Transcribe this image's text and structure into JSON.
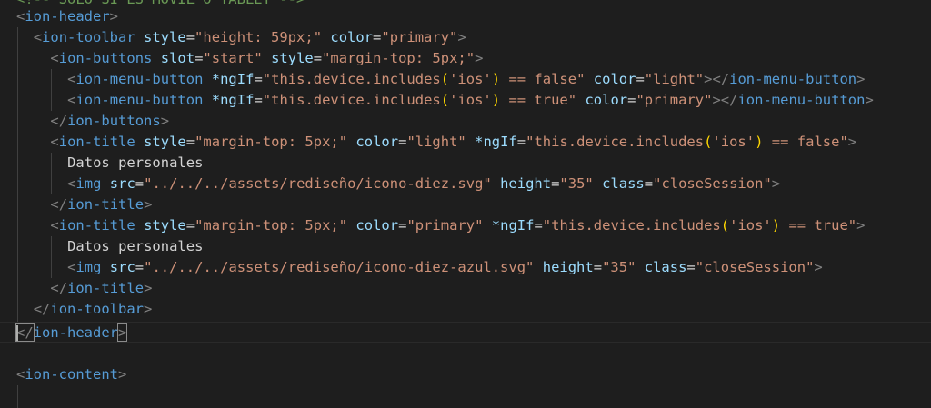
{
  "colors": {
    "background": "#1e1e1e",
    "tag_bracket": "#808080",
    "tag_name": "#569cd6",
    "attribute": "#9cdcfe",
    "string": "#ce9178",
    "text": "#d4d4d4",
    "comment": "#6a9955",
    "paren": "#ffd700"
  },
  "lines": [
    [
      [
        "comment",
        "<!-- SOLO SI ES MOVIL O TABLET -->"
      ]
    ],
    [
      [
        "br",
        "<"
      ],
      [
        "tag",
        "ion-header"
      ],
      [
        "br",
        ">"
      ]
    ],
    [
      [
        "br",
        "<"
      ],
      [
        "tag",
        "ion-toolbar"
      ],
      [
        "t",
        " "
      ],
      [
        "attr",
        "style"
      ],
      [
        "t",
        "="
      ],
      [
        "str",
        "\"height: 59px;\""
      ],
      [
        "t",
        " "
      ],
      [
        "attr",
        "color"
      ],
      [
        "t",
        "="
      ],
      [
        "str",
        "\"primary\""
      ],
      [
        "br",
        ">"
      ]
    ],
    [
      [
        "br",
        "<"
      ],
      [
        "tag",
        "ion-buttons"
      ],
      [
        "t",
        " "
      ],
      [
        "attr",
        "slot"
      ],
      [
        "t",
        "="
      ],
      [
        "str",
        "\"start\""
      ],
      [
        "t",
        " "
      ],
      [
        "attr",
        "style"
      ],
      [
        "t",
        "="
      ],
      [
        "str",
        "\"margin-top: 5px;\""
      ],
      [
        "br",
        ">"
      ]
    ],
    [
      [
        "br",
        "<"
      ],
      [
        "tag",
        "ion-menu-button"
      ],
      [
        "t",
        " "
      ],
      [
        "attr",
        "*ngIf"
      ],
      [
        "t",
        "="
      ],
      [
        "str",
        "\"this.device.includes"
      ],
      [
        "paren",
        "("
      ],
      [
        "str",
        "'ios'"
      ],
      [
        "paren",
        ")"
      ],
      [
        "str",
        " == false\""
      ],
      [
        "t",
        " "
      ],
      [
        "attr",
        "color"
      ],
      [
        "t",
        "="
      ],
      [
        "str",
        "\"light\""
      ],
      [
        "br",
        "></"
      ],
      [
        "tag",
        "ion-menu-button"
      ],
      [
        "br",
        ">"
      ]
    ],
    [
      [
        "br",
        "<"
      ],
      [
        "tag",
        "ion-menu-button"
      ],
      [
        "t",
        " "
      ],
      [
        "attr",
        "*ngIf"
      ],
      [
        "t",
        "="
      ],
      [
        "str",
        "\"this.device.includes"
      ],
      [
        "paren",
        "("
      ],
      [
        "str",
        "'ios'"
      ],
      [
        "paren",
        ")"
      ],
      [
        "str",
        " == true\""
      ],
      [
        "t",
        " "
      ],
      [
        "attr",
        "color"
      ],
      [
        "t",
        "="
      ],
      [
        "str",
        "\"primary\""
      ],
      [
        "br",
        "></"
      ],
      [
        "tag",
        "ion-menu-button"
      ],
      [
        "br",
        ">"
      ]
    ],
    [
      [
        "br",
        "</"
      ],
      [
        "tag",
        "ion-buttons"
      ],
      [
        "br",
        ">"
      ]
    ],
    [
      [
        "br",
        "<"
      ],
      [
        "tag",
        "ion-title"
      ],
      [
        "t",
        " "
      ],
      [
        "attr",
        "style"
      ],
      [
        "t",
        "="
      ],
      [
        "str",
        "\"margin-top: 5px;\""
      ],
      [
        "t",
        " "
      ],
      [
        "attr",
        "color"
      ],
      [
        "t",
        "="
      ],
      [
        "str",
        "\"light\""
      ],
      [
        "t",
        " "
      ],
      [
        "attr",
        "*ngIf"
      ],
      [
        "t",
        "="
      ],
      [
        "str",
        "\"this.device.includes"
      ],
      [
        "paren",
        "("
      ],
      [
        "str",
        "'ios'"
      ],
      [
        "paren",
        ")"
      ],
      [
        "str",
        " == false\""
      ],
      [
        "br",
        ">"
      ]
    ],
    [
      [
        "t",
        "Datos personales"
      ]
    ],
    [
      [
        "br",
        "<"
      ],
      [
        "tag",
        "img"
      ],
      [
        "t",
        " "
      ],
      [
        "attr",
        "src"
      ],
      [
        "t",
        "="
      ],
      [
        "str",
        "\"../../../assets/rediseño/icono-diez.svg\""
      ],
      [
        "t",
        " "
      ],
      [
        "attr",
        "height"
      ],
      [
        "t",
        "="
      ],
      [
        "str",
        "\"35\""
      ],
      [
        "t",
        " "
      ],
      [
        "attr",
        "class"
      ],
      [
        "t",
        "="
      ],
      [
        "str",
        "\"closeSession\""
      ],
      [
        "br",
        ">"
      ]
    ],
    [
      [
        "br",
        "</"
      ],
      [
        "tag",
        "ion-title"
      ],
      [
        "br",
        ">"
      ]
    ],
    [
      [
        "br",
        "<"
      ],
      [
        "tag",
        "ion-title"
      ],
      [
        "t",
        " "
      ],
      [
        "attr",
        "style"
      ],
      [
        "t",
        "="
      ],
      [
        "str",
        "\"margin-top: 5px;\""
      ],
      [
        "t",
        " "
      ],
      [
        "attr",
        "color"
      ],
      [
        "t",
        "="
      ],
      [
        "str",
        "\"primary\""
      ],
      [
        "t",
        " "
      ],
      [
        "attr",
        "*ngIf"
      ],
      [
        "t",
        "="
      ],
      [
        "str",
        "\"this.device.includes"
      ],
      [
        "paren",
        "("
      ],
      [
        "str",
        "'ios'"
      ],
      [
        "paren",
        ")"
      ],
      [
        "str",
        " == true\""
      ],
      [
        "br",
        ">"
      ]
    ],
    [
      [
        "t",
        "Datos personales"
      ]
    ],
    [
      [
        "br",
        "<"
      ],
      [
        "tag",
        "img"
      ],
      [
        "t",
        " "
      ],
      [
        "attr",
        "src"
      ],
      [
        "t",
        "="
      ],
      [
        "str",
        "\"../../../assets/rediseño/icono-diez-azul.svg\""
      ],
      [
        "t",
        " "
      ],
      [
        "attr",
        "height"
      ],
      [
        "t",
        "="
      ],
      [
        "str",
        "\"35\""
      ],
      [
        "t",
        " "
      ],
      [
        "attr",
        "class"
      ],
      [
        "t",
        "="
      ],
      [
        "str",
        "\"closeSession\""
      ],
      [
        "br",
        ">"
      ]
    ],
    [
      [
        "br",
        "</"
      ],
      [
        "tag",
        "ion-title"
      ],
      [
        "br",
        ">"
      ]
    ],
    [
      [
        "br",
        "</"
      ],
      [
        "tag",
        "ion-toolbar"
      ],
      [
        "br",
        ">"
      ]
    ],
    [
      [
        "bm",
        "</"
      ],
      [
        "tag",
        "ion-header"
      ],
      [
        "bm",
        ">"
      ]
    ],
    [],
    [
      [
        "br",
        "<"
      ],
      [
        "tag",
        "ion-content"
      ],
      [
        "br",
        ">"
      ]
    ]
  ]
}
